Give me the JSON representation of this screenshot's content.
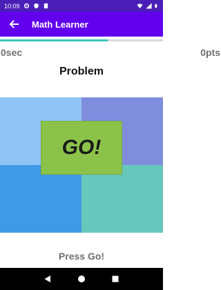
{
  "status_bar": {
    "time": "10:09",
    "icons": [
      "gear-icon",
      "shield-icon",
      "sd-card-icon",
      "wifi-icon",
      "signal-icon",
      "battery-icon"
    ]
  },
  "app_bar": {
    "title": "Math Learner",
    "back_icon": "arrow-back-icon"
  },
  "progress": {
    "fraction": 0.66
  },
  "game": {
    "timer": "0sec",
    "points": "0pts",
    "problem_label": "Problem",
    "go_label": "GO!",
    "hint": "Press Go!"
  },
  "colors": {
    "status_bar": "#4a1fb8",
    "app_bar": "#6200ee",
    "progress": "#36c6b5",
    "cell_top_left": "#90c4f5",
    "cell_top_right": "#7f8edc",
    "cell_bottom_left": "#3f9ae6",
    "cell_bottom_right": "#66c7bd",
    "go_button": "#8bc34a"
  },
  "nav_bar": {
    "icons": [
      "back-triangle-icon",
      "home-circle-icon",
      "recents-square-icon"
    ]
  }
}
